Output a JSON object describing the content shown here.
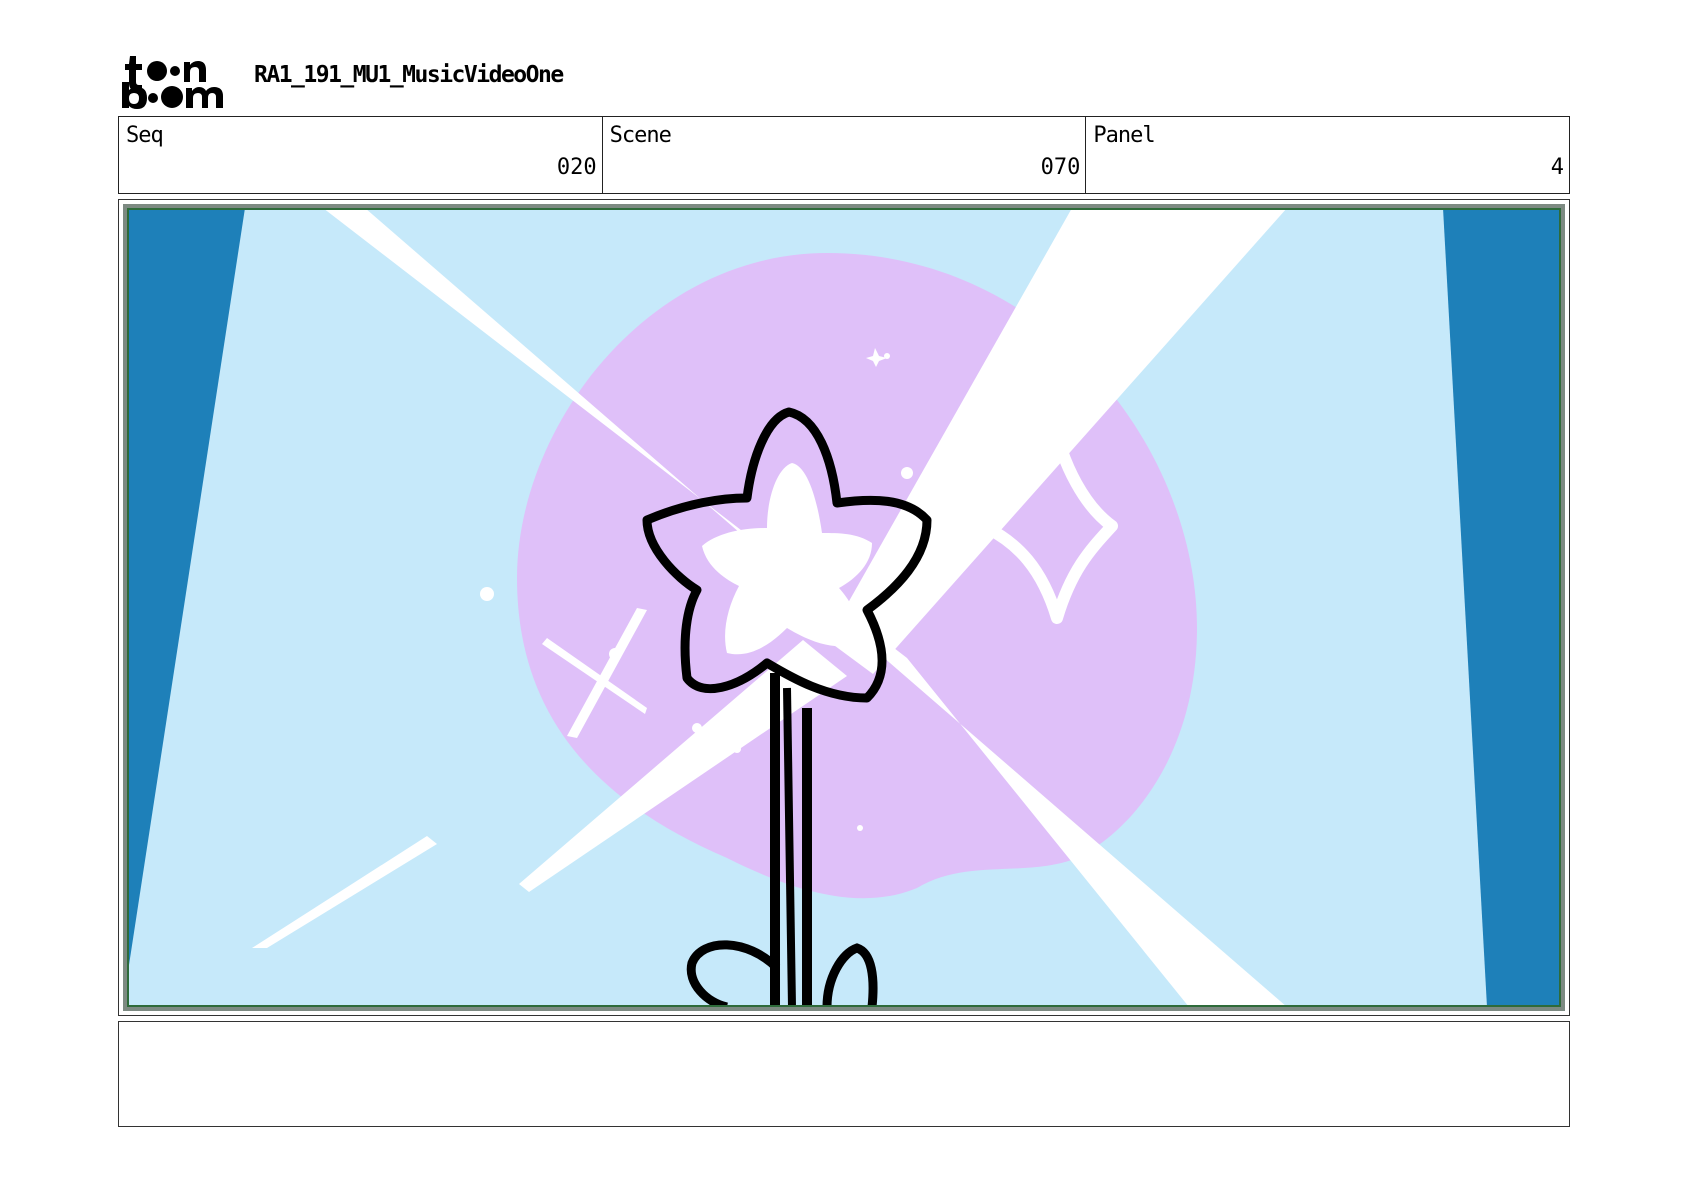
{
  "header": {
    "logo_text": "toon boom",
    "project_title": "RA1_191_MU1_MusicVideoOne"
  },
  "info": {
    "seq_label": "Seq",
    "seq_value": "020",
    "scene_label": "Scene",
    "scene_value": "070",
    "panel_label": "Panel",
    "panel_value": "4"
  },
  "panel_art": {
    "description_colors": {
      "curtain": "#1e80b9",
      "sky": "#c6e9fa",
      "glow_circle": "#dfc0f9",
      "light_beams": "#ffffff",
      "outline": "#000000",
      "frame_border": "#2e6b3a"
    }
  },
  "notes": {
    "text": ""
  }
}
